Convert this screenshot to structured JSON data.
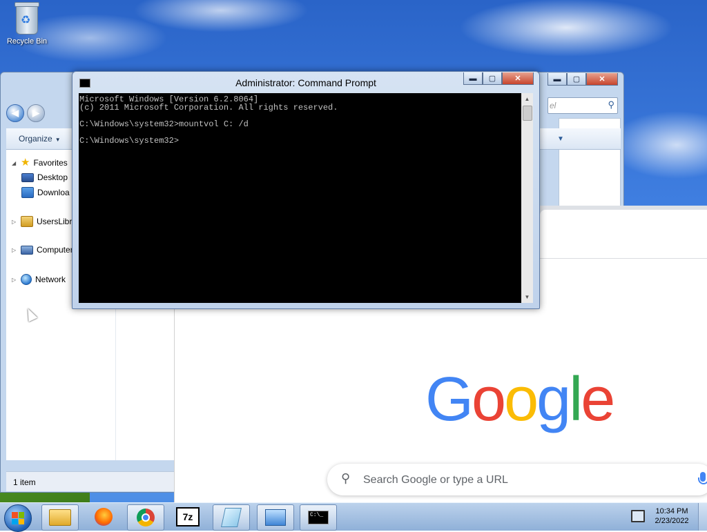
{
  "desktop": {
    "recycle_bin_label": "Recycle Bin"
  },
  "explorer": {
    "search_placeholder": "el",
    "organize_label": "Organize",
    "nav": {
      "favorites": "Favorites",
      "desktop": "Desktop",
      "downloads": "Downloa",
      "libraries": "UsersLibra",
      "computer": "Computer",
      "network": "Network"
    },
    "status": "1 item",
    "controls": {
      "minimize": "▬",
      "maximize": "▢",
      "close": "✕"
    }
  },
  "cmd": {
    "title": "Administrator: Command Prompt",
    "lines": [
      "Microsoft Windows [Version 6.2.8064]",
      "(c) 2011 Microsoft Corporation. All rights reserved.",
      "",
      "C:\\Windows\\system32>mountvol C: /d",
      "",
      "C:\\Windows\\system32>"
    ],
    "controls": {
      "minimize": "▬",
      "maximize": "▢",
      "close": "✕"
    }
  },
  "chrome": {
    "logo_letters": [
      "G",
      "o",
      "o",
      "g",
      "l",
      "e"
    ],
    "search_placeholder": "Search Google or type a URL"
  },
  "taskbar": {
    "apps": [
      "windows-explorer",
      "firefox",
      "chrome",
      "7-zip",
      "notepad",
      "remote-connection",
      "command-prompt"
    ],
    "sevenzip_label": "7z",
    "cmd_icon_text": "C:\\_",
    "clock_time": "10:34 PM",
    "clock_date": "2/23/2022"
  },
  "colors": {
    "google_blue": "#4285f4",
    "google_red": "#ea4335",
    "google_yellow": "#fbbc05",
    "google_green": "#34a853",
    "console_bg": "#000000",
    "console_text": "#c0c0c0"
  },
  "icons": {
    "recycle_bin": "recycle-bin-icon",
    "start": "windows-logo-icon",
    "search": "search-icon",
    "mic": "microphone-icon"
  }
}
